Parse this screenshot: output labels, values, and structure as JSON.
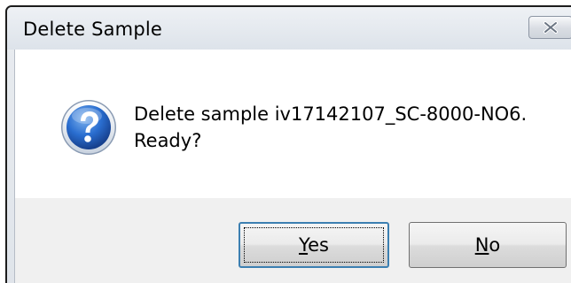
{
  "dialog": {
    "title": "Delete Sample",
    "close_icon": "close-icon",
    "message_icon": "question-icon",
    "message_line1": "Delete sample iv17142107_SC-8000-NO6.",
    "message_line2": "Ready?",
    "buttons": {
      "yes": {
        "mnemonic": "Y",
        "rest": "es"
      },
      "no": {
        "mnemonic": "N",
        "rest": "o"
      }
    }
  },
  "colors": {
    "title_bar": "#dde3ea",
    "default_button_border": "#3c7fb1",
    "question_icon_blue": "#1f5fb8"
  }
}
